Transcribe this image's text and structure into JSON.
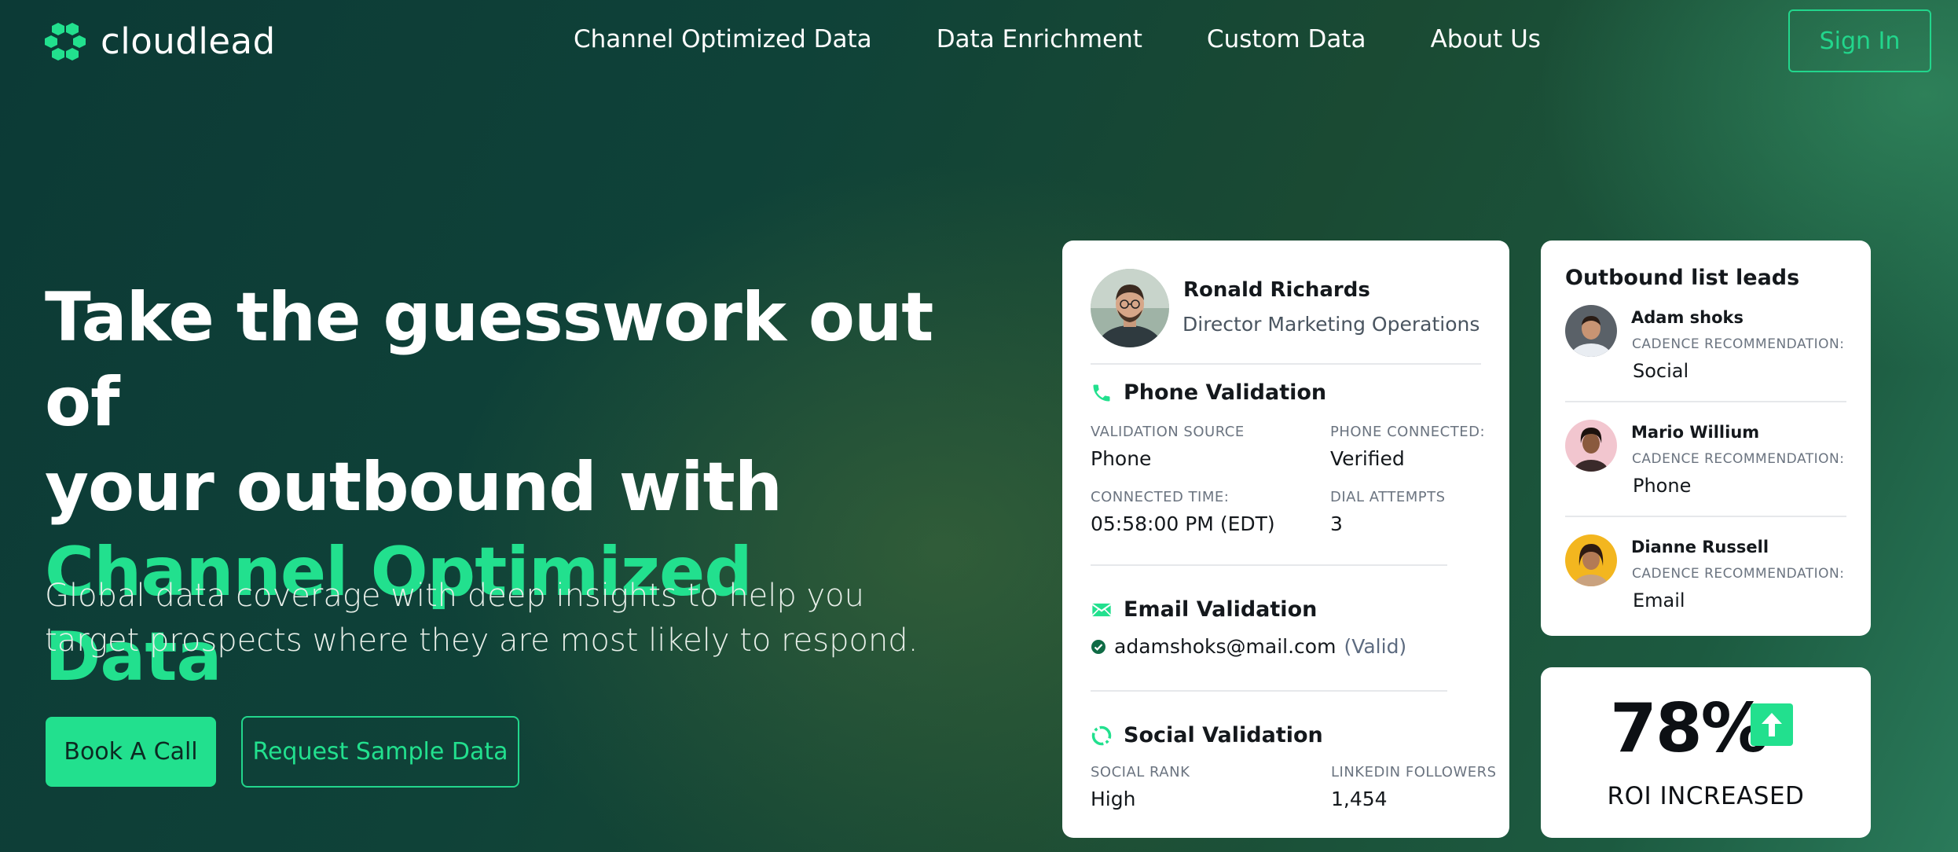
{
  "brand": {
    "name": "cloudlead",
    "accent": "#22e08e"
  },
  "nav": {
    "links": [
      "Channel Optimized Data",
      "Data Enrichment",
      "Custom Data",
      "About Us"
    ],
    "signin_label": "Sign In"
  },
  "hero": {
    "title_line1": "Take the guesswork out of",
    "title_line2": "your outbound with",
    "title_accent": "Channel Optimized Data",
    "subtitle_line1": "Global data coverage with deep insights to help you",
    "subtitle_line2": "target prospects where they are most likely to respond.",
    "primary_cta": "Book A Call",
    "secondary_cta": "Request Sample Data"
  },
  "profile_card": {
    "name": "Ronald Richards",
    "role": "Director Marketing Operations",
    "phone": {
      "title": "Phone Validation",
      "validation_source_label": "VALIDATION SOURCE",
      "validation_source_value": "Phone",
      "phone_connected_label": "PHONE CONNECTED:",
      "phone_connected_value": "Verified",
      "connected_time_label": "CONNECTED TIME:",
      "connected_time_value": "05:58:00 PM (EDT)",
      "dial_attempts_label": "DIAL ATTEMPTS",
      "dial_attempts_value": "3"
    },
    "email": {
      "title": "Email Validation",
      "address": "adamshoks@mail.com",
      "status": "(Valid)"
    },
    "social": {
      "title": "Social Validation",
      "social_rank_label": "SOCIAL RANK",
      "social_rank_value": "High",
      "linkedin_label": "LINKEDIN FOLLOWERS",
      "linkedin_value": "1,454"
    }
  },
  "leads_card": {
    "title": "Outbound list leads",
    "label": "CADENCE RECOMMENDATION:",
    "leads": [
      {
        "name": "Adam shoks",
        "recommendation": "Social"
      },
      {
        "name": "Mario Willium",
        "recommendation": "Phone"
      },
      {
        "name": "Dianne Russell",
        "recommendation": "Email"
      }
    ]
  },
  "roi_card": {
    "percent": "78%",
    "label": "ROI INCREASED"
  }
}
